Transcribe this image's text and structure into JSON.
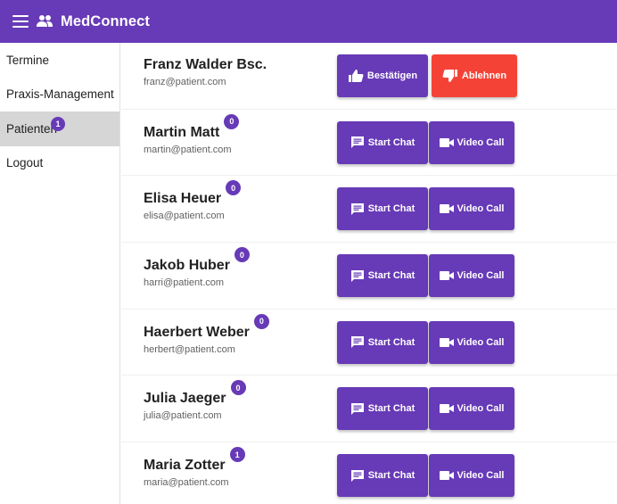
{
  "appbar": {
    "title": "MedConnect",
    "menu_icon": "menu-icon",
    "logo_icon": "people-icon"
  },
  "colors": {
    "primary": "#673ab7",
    "danger": "#f44336",
    "active_nav": "#d6d6d6"
  },
  "sidebar": {
    "items": [
      {
        "label": "Termine"
      },
      {
        "label": "Praxis-Management"
      },
      {
        "label": "Patienten",
        "badge": "1",
        "active": true
      },
      {
        "label": "Logout"
      }
    ]
  },
  "patients": [
    {
      "name": "Franz Walder Bsc.",
      "email": "franz@patient.com",
      "badge": "",
      "actions": [
        "Bestätigen",
        "Ablehnen"
      ]
    },
    {
      "name": "Martin Matt",
      "email": "martin@patient.com",
      "badge": "0",
      "actions": [
        "Start Chat",
        "Video Call"
      ]
    },
    {
      "name": "Elisa Heuer",
      "email": "elisa@patient.com",
      "badge": "0",
      "actions": [
        "Start Chat",
        "Video Call"
      ]
    },
    {
      "name": "Jakob Huber",
      "email": "harri@patient.com",
      "badge": "0",
      "actions": [
        "Start Chat",
        "Video Call"
      ]
    },
    {
      "name": "Haerbert Weber",
      "email": "herbert@patient.com",
      "badge": "0",
      "actions": [
        "Start Chat",
        "Video Call"
      ]
    },
    {
      "name": "Julia Jaeger",
      "email": "julia@patient.com",
      "badge": "0",
      "actions": [
        "Start Chat",
        "Video Call"
      ]
    },
    {
      "name": "Maria Zotter",
      "email": "maria@patient.com",
      "badge": "1",
      "actions": [
        "Start Chat",
        "Video Call"
      ]
    }
  ]
}
